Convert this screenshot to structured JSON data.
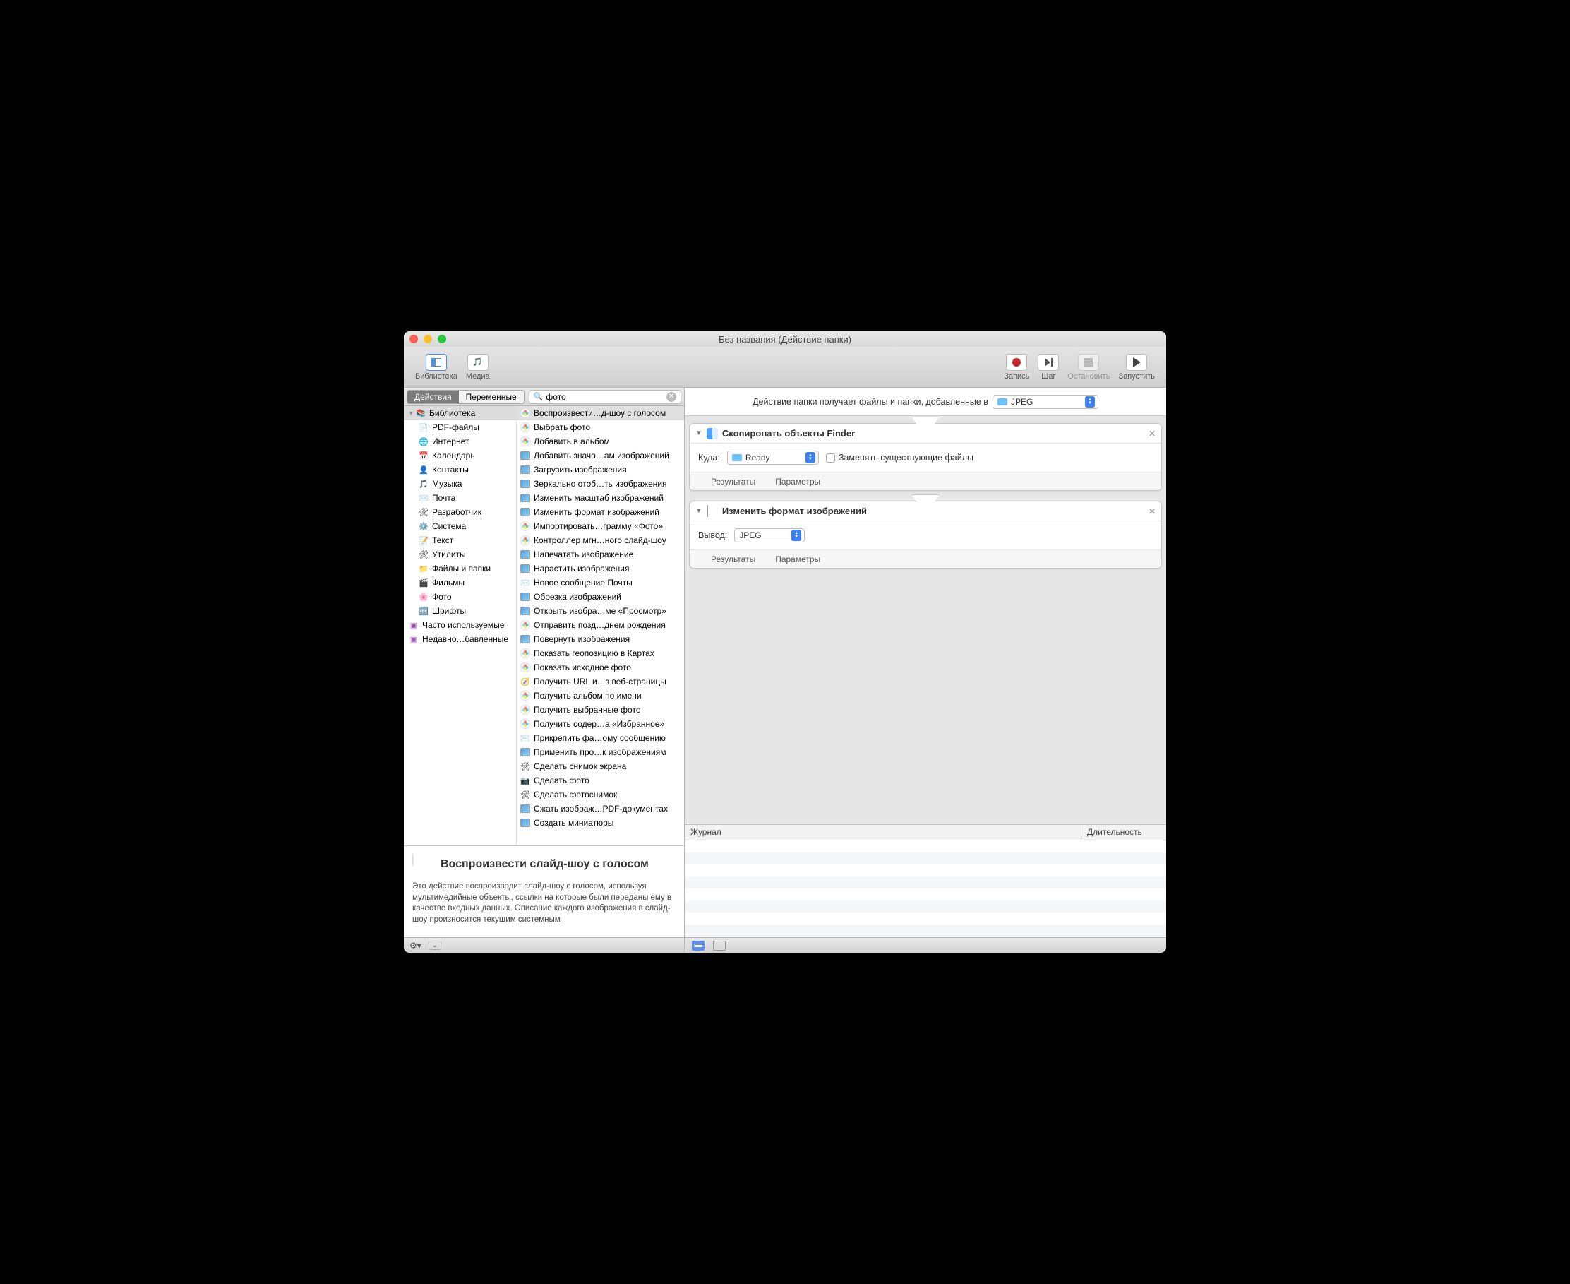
{
  "window": {
    "title": "Без названия (Действие папки)"
  },
  "toolbar": {
    "library": "Библиотека",
    "media": "Медиа",
    "record": "Запись",
    "step": "Шаг",
    "stop": "Остановить",
    "run": "Запустить"
  },
  "tabs": {
    "actions": "Действия",
    "variables": "Переменные"
  },
  "search": {
    "value": "фото",
    "placeholder": ""
  },
  "library": {
    "root": "Библиотека",
    "items": [
      {
        "label": "PDF-файлы",
        "icon": "📄"
      },
      {
        "label": "Интернет",
        "icon": "🌐"
      },
      {
        "label": "Календарь",
        "icon": "📅"
      },
      {
        "label": "Контакты",
        "icon": "👤"
      },
      {
        "label": "Музыка",
        "icon": "🎵"
      },
      {
        "label": "Почта",
        "icon": "✉️"
      },
      {
        "label": "Разработчик",
        "icon": "🛠"
      },
      {
        "label": "Система",
        "icon": "⚙️"
      },
      {
        "label": "Текст",
        "icon": "📝"
      },
      {
        "label": "Утилиты",
        "icon": "🛠"
      },
      {
        "label": "Файлы и папки",
        "icon": "📁"
      },
      {
        "label": "Фильмы",
        "icon": "🎬"
      },
      {
        "label": "Фото",
        "icon": "🌸"
      },
      {
        "label": "Шрифты",
        "icon": "🔤"
      }
    ],
    "smart": [
      {
        "label": "Часто используемые"
      },
      {
        "label": "Недавно…бавленные"
      }
    ]
  },
  "actions": [
    {
      "label": "Воспроизвести…д-шоу с голосом",
      "icon": "flower",
      "sel": true
    },
    {
      "label": "Выбрать фото",
      "icon": "flower"
    },
    {
      "label": "Добавить в альбом",
      "icon": "flower"
    },
    {
      "label": "Добавить значо…ам изображений",
      "icon": "preview"
    },
    {
      "label": "Загрузить изображения",
      "icon": "preview"
    },
    {
      "label": "Зеркально отоб…ть изображения",
      "icon": "preview"
    },
    {
      "label": "Изменить масштаб изображений",
      "icon": "preview"
    },
    {
      "label": "Изменить формат изображений",
      "icon": "preview"
    },
    {
      "label": "Импортировать…грамму «Фото»",
      "icon": "flower"
    },
    {
      "label": "Контроллер мгн…ного слайд-шоу",
      "icon": "flower"
    },
    {
      "label": "Напечатать изображение",
      "icon": "preview"
    },
    {
      "label": "Нарастить изображения",
      "icon": "preview"
    },
    {
      "label": "Новое сообщение Почты",
      "icon": "mail"
    },
    {
      "label": "Обрезка изображений",
      "icon": "preview"
    },
    {
      "label": "Открыть изобра…ме «Просмотр»",
      "icon": "preview"
    },
    {
      "label": "Отправить позд…днем рождения",
      "icon": "flower"
    },
    {
      "label": "Повернуть изображения",
      "icon": "preview"
    },
    {
      "label": "Показать геопозицию в Картах",
      "icon": "flower"
    },
    {
      "label": "Показать исходное фото",
      "icon": "flower"
    },
    {
      "label": "Получить URL и…з веб-страницы",
      "icon": "safari"
    },
    {
      "label": "Получить альбом по имени",
      "icon": "flower"
    },
    {
      "label": "Получить выбранные фото",
      "icon": "flower"
    },
    {
      "label": "Получить содер…а «Избранное»",
      "icon": "flower"
    },
    {
      "label": "Прикрепить фа…ому сообщению",
      "icon": "mail"
    },
    {
      "label": "Применить про…к изображениям",
      "icon": "preview"
    },
    {
      "label": "Сделать снимок экрана",
      "icon": "tools"
    },
    {
      "label": "Сделать фото",
      "icon": "camera"
    },
    {
      "label": "Сделать фотоснимок",
      "icon": "tools"
    },
    {
      "label": "Сжать изображ…PDF-документах",
      "icon": "preview"
    },
    {
      "label": "Создать миниатюры",
      "icon": "preview"
    }
  ],
  "description": {
    "title": "Воспроизвести слайд-шоу с голосом",
    "body": "Это действие воспроизводит слайд-шоу с голосом, используя мультимедийные объекты, ссылки на которые были переданы ему в качестве входных данных. Описание каждого изображения в слайд-шоу произносится текущим системным"
  },
  "workflow_header": {
    "text": "Действие папки получает файлы и папки, добавленные в",
    "folder": "JPEG"
  },
  "cards": {
    "copy": {
      "title": "Скопировать объекты Finder",
      "where_label": "Куда:",
      "where_value": "Ready",
      "replace_label": "Заменять существующие файлы",
      "results": "Результаты",
      "params": "Параметры"
    },
    "format": {
      "title": "Изменить формат изображений",
      "output_label": "Вывод:",
      "output_value": "JPEG",
      "results": "Результаты",
      "params": "Параметры"
    }
  },
  "log": {
    "col1": "Журнал",
    "col2": "Длительность"
  }
}
